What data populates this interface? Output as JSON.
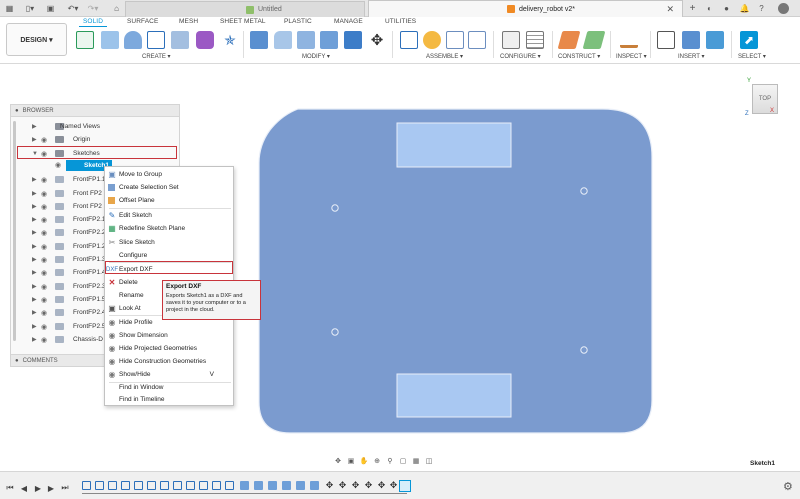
{
  "title_bar": {
    "tabs": [
      {
        "label": "Untitled",
        "active": false
      },
      {
        "label": "delivery_robot v2*",
        "active": true
      }
    ]
  },
  "ribbon": {
    "tabs": [
      "SOLID",
      "SURFACE",
      "MESH",
      "SHEET METAL",
      "PLASTIC",
      "MANAGE",
      "UTILITIES"
    ],
    "active_tab": "SOLID",
    "workspace_button": "DESIGN ▾",
    "groups": [
      "CREATE ▾",
      "MODIFY ▾",
      "ASSEMBLE ▾",
      "CONFIGURE ▾",
      "CONSTRUCT ▾",
      "INSPECT ▾",
      "INSERT ▾",
      "SELECT ▾"
    ]
  },
  "browser": {
    "title": "BROWSER",
    "comments_label": "COMMENTS",
    "items": [
      {
        "label": "Named Views",
        "icon": "folder-icon"
      },
      {
        "label": "Origin",
        "icon": "folder-icon"
      },
      {
        "label": "Sketches",
        "icon": "folder-icon",
        "expanded": true,
        "highlighted": true
      },
      {
        "label": "Sketch1",
        "icon": "sketch-icon",
        "selected": true
      },
      {
        "label": "FrontFP1.1",
        "icon": "body-icon"
      },
      {
        "label": "Front FP2",
        "icon": "body-icon"
      },
      {
        "label": "Front FP2",
        "icon": "body-icon"
      },
      {
        "label": "FrontFP2.1",
        "icon": "body-icon"
      },
      {
        "label": "FrontFP2.2",
        "icon": "body-icon"
      },
      {
        "label": "FrontFP1.2",
        "icon": "body-icon"
      },
      {
        "label": "FrontFP1.3",
        "icon": "body-icon"
      },
      {
        "label": "FrontFP1.4",
        "icon": "body-icon"
      },
      {
        "label": "FrontFP2.3",
        "icon": "body-icon"
      },
      {
        "label": "FrontFP1.5",
        "icon": "body-icon"
      },
      {
        "label": "FrontFP2.4",
        "icon": "body-icon"
      },
      {
        "label": "FrontFP2.5",
        "icon": "body-icon"
      },
      {
        "label": "Chassis-D",
        "icon": "body-icon"
      }
    ]
  },
  "context_menu": {
    "items": [
      {
        "label": "Move to Group",
        "icon": "move-group-icon"
      },
      {
        "label": "Create Selection Set",
        "icon": "selection-set-icon"
      },
      {
        "label": "Offset Plane",
        "icon": "offset-plane-icon"
      },
      {
        "label": "Edit Sketch",
        "icon": "edit-sketch-icon"
      },
      {
        "label": "Redefine Sketch Plane",
        "icon": "redefine-plane-icon"
      },
      {
        "label": "Slice Sketch",
        "icon": "slice-icon"
      },
      {
        "label": "Configure",
        "icon": "configure-icon"
      },
      {
        "label": "Export DXF",
        "icon": "export-dxf-icon",
        "highlighted": true
      },
      {
        "label": "Delete",
        "icon": "delete-icon"
      },
      {
        "label": "Rename",
        "icon": ""
      },
      {
        "label": "Look At",
        "icon": "look-at-icon"
      },
      {
        "label": "Hide Profile",
        "icon": "eye-icon"
      },
      {
        "label": "Show Dimension",
        "icon": "eye-icon"
      },
      {
        "label": "Hide Projected Geometries",
        "icon": "eye-icon"
      },
      {
        "label": "Hide Construction Geometries",
        "icon": "eye-icon"
      },
      {
        "label": "Show/Hide",
        "icon": "eye-icon",
        "shortcut": "V"
      },
      {
        "label": "Find in Window",
        "icon": ""
      },
      {
        "label": "Find in Timeline",
        "icon": ""
      }
    ]
  },
  "tooltip": {
    "title": "Export DXF",
    "line1": "Exports Sketch1 as a DXF and",
    "line2": "saves it to your computer or to a",
    "line3": "project in the cloud."
  },
  "viewcube_label": "TOP",
  "axis_labels": {
    "y": "Y",
    "x": "X",
    "z": "Z"
  },
  "status": {
    "sketch_label": "Sketch1"
  },
  "colors": {
    "accent": "#0696d7",
    "highlight_red": "#c8343b",
    "sketch_fill": "#7b9bcf",
    "cutout_fill": "#a9c8f2",
    "chassis_stroke": "#e8eef8"
  }
}
